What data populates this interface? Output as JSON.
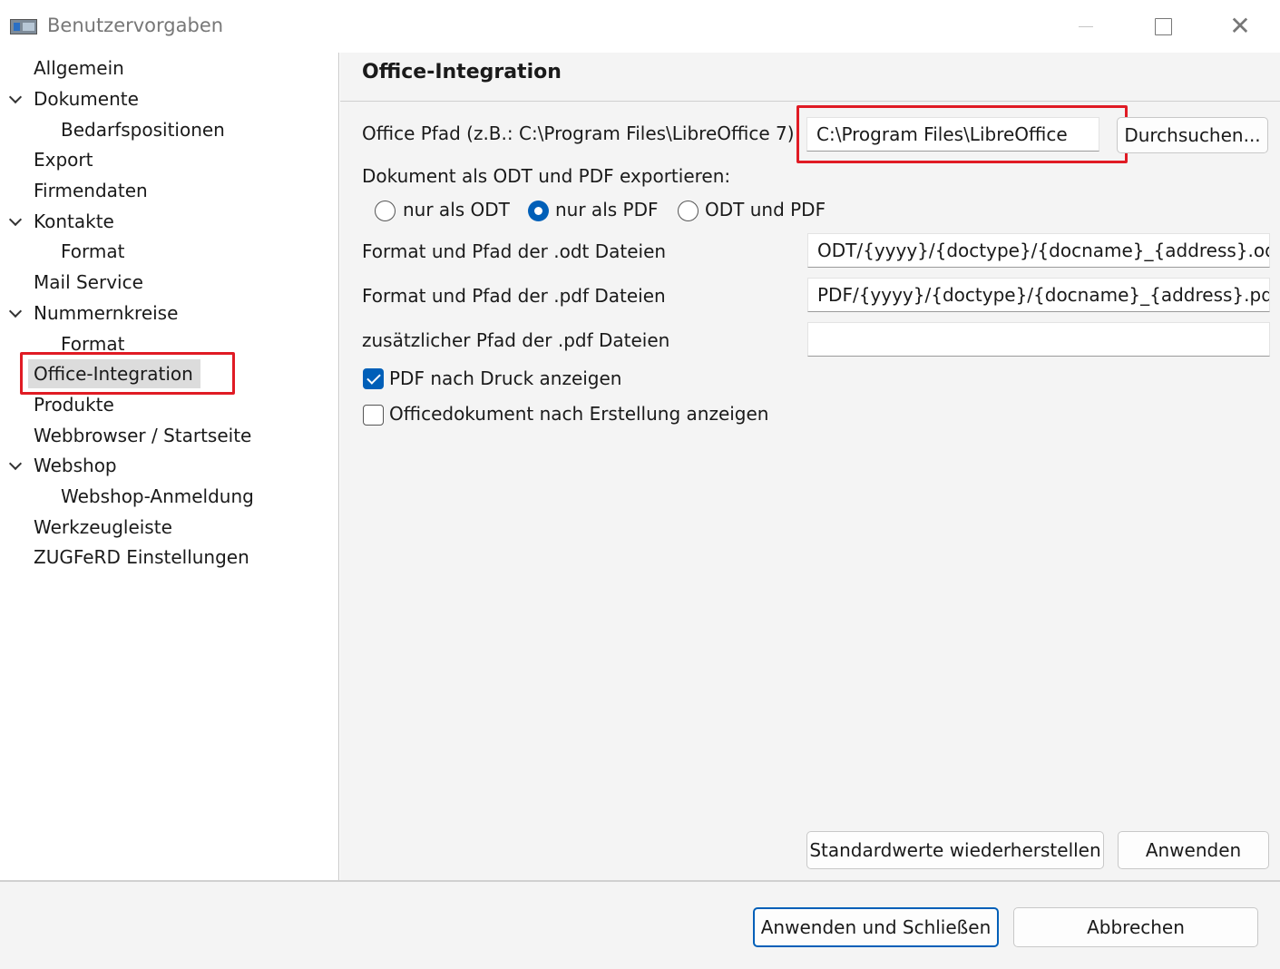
{
  "window": {
    "title": "Benutzervorgaben",
    "icon": "app-window-icon",
    "minimize": "—",
    "maximize": "",
    "close": "✕"
  },
  "sidebar": {
    "items": [
      {
        "label": "Allgemein"
      },
      {
        "label": "Dokumente",
        "expanded": true
      },
      {
        "label": "Bedarfspositionen"
      },
      {
        "label": "Export"
      },
      {
        "label": "Firmendaten"
      },
      {
        "label": "Kontakte",
        "expanded": true
      },
      {
        "label": "Format"
      },
      {
        "label": "Mail Service"
      },
      {
        "label": "Nummernkreise",
        "expanded": true
      },
      {
        "label": "Format"
      },
      {
        "label": "Office-Integration",
        "selected": true
      },
      {
        "label": "Produkte"
      },
      {
        "label": "Webbrowser / Startseite"
      },
      {
        "label": "Webshop",
        "expanded": true
      },
      {
        "label": "Webshop-Anmeldung"
      },
      {
        "label": "Werkzeugleiste"
      },
      {
        "label": "ZUGFeRD Einstellungen"
      }
    ]
  },
  "main": {
    "title": "Office-Integration",
    "office_path": {
      "label": "Office Pfad (z.B.: C:\\Program Files\\LibreOffice 7)",
      "value": "C:\\Program Files\\LibreOffice",
      "browse_label": "Durchsuchen..."
    },
    "export": {
      "label": "Dokument als ODT und PDF exportieren:",
      "options": [
        {
          "label": "nur als ODT",
          "checked": false
        },
        {
          "label": "nur als PDF",
          "checked": true
        },
        {
          "label": "ODT und PDF",
          "checked": false
        }
      ]
    },
    "odt_format": {
      "label": "Format und Pfad der .odt Dateien",
      "value": "ODT/{yyyy}/{doctype}/{docname}_{address}.odt"
    },
    "pdf_format": {
      "label": "Format und Pfad der .pdf Dateien",
      "value": "PDF/{yyyy}/{doctype}/{docname}_{address}.pdf"
    },
    "extra_pdf_path": {
      "label": "zusätzlicher Pfad der .pdf Dateien",
      "value": ""
    },
    "checkboxes": [
      {
        "label": "PDF nach Druck anzeigen",
        "checked": true
      },
      {
        "label": "Officedokument nach Erstellung anzeigen",
        "checked": false
      }
    ],
    "restore_defaults_label": "Standardwerte wiederherstellen",
    "apply_label": "Anwenden"
  },
  "footer": {
    "apply_close_label": "Anwenden und Schließen",
    "cancel_label": "Abbrechen"
  },
  "colors": {
    "accent": "#005fb8",
    "highlight_annotation": "#e01b24"
  }
}
